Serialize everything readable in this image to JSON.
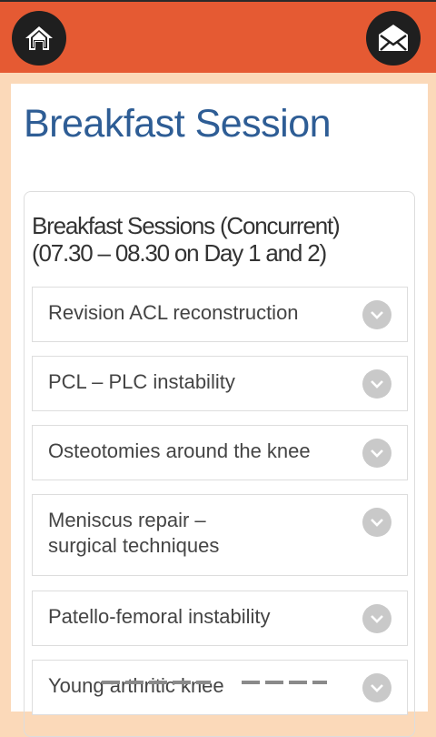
{
  "header": {
    "home_icon": "home-icon",
    "mail_icon": "envelope-icon",
    "bar_color": "#e55a33"
  },
  "page": {
    "title": "Breakfast Session",
    "title_color": "#2e5d95",
    "background": "#fbd9b9"
  },
  "section": {
    "heading_line1": "Breakfast Sessions (Concurrent)",
    "heading_line2": "(07.30 – 08.30 on Day 1 and 2)"
  },
  "sessions": [
    {
      "label": "Revision ACL reconstruction"
    },
    {
      "label": "PCL – PLC instability"
    },
    {
      "label": "Osteotomies around the knee"
    },
    {
      "label_line1": "Meniscus repair –",
      "label_line2": "surgical techniques"
    },
    {
      "label": "Patello-femoral instability"
    },
    {
      "label": "Young arthritic knee"
    }
  ],
  "icons": {
    "expand": "chevron-down-icon"
  }
}
